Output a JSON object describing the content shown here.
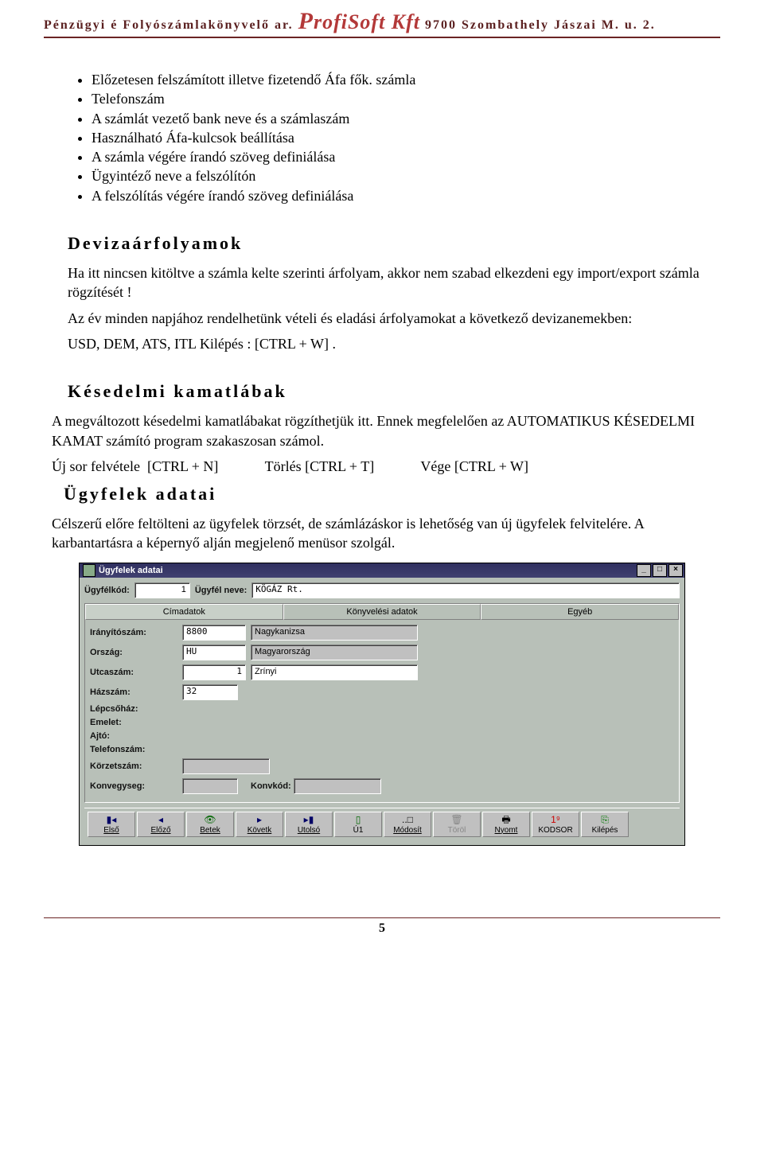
{
  "header": {
    "left": "Pénzügyi é Folyószámlakönyvelő ar.",
    "brand": "ProfiSoft Kft",
    "right": "9700 Szombathely Jászai M. u. 2."
  },
  "bullets": [
    "Előzetesen felszámított illetve fizetendő Áfa fők. számla",
    "Telefonszám",
    "A számlát vezető bank neve és a számlaszám",
    "Használható Áfa-kulcsok beállítása",
    "A számla végére írandó szöveg definiálása",
    "Ügyintéző neve a felszólítón",
    "A felszólítás végére írandó szöveg definiálása"
  ],
  "sec1": {
    "title": "Devizaárfolyamok",
    "p1": "Ha itt nincsen kitöltve a számla kelte szerinti  árfolyam, akkor nem szabad elkezdeni egy import/export számla rögzítését !",
    "p2": "Az év minden napjához rendelhetünk vételi és eladási árfolyamokat a következő devizanemekben:",
    "p3": "USD, DEM, ATS, ITL    Kilépés : [CTRL + W] ."
  },
  "sec2": {
    "title": "Késedelmi kamatlábak",
    "p1": "A megváltozott késedelmi kamatlábakat rögzíthetjük itt. Ennek megfelelően az AUTOMATIKUS KÉSEDELMI KAMAT számító program szakaszosan számol.",
    "p2": "Új sor felvétele  [CTRL + N]             Törlés [CTRL + T]             Vége [CTRL + W]"
  },
  "sec3": {
    "title": "Ügyfelek adatai",
    "p1": "Célszerű előre feltölteni az ügyfelek törzsét, de számlázáskor is lehetőség van új ügyfelek felvitelére. A karbantartásra a képernyő alján megjelenő menüsor szolgál."
  },
  "window": {
    "title": "Ügyfelek adatai",
    "ugyfelkod_label": "Ügyfélkód:",
    "ugyfelkod_value": "1",
    "ugyfelnev_label": "Ügyfél neve:",
    "ugyfelnev_value": "KÖGÁZ Rt.",
    "tabs": {
      "cim": "Címadatok",
      "kony": "Könyvelési adatok",
      "egyeb": "Egyéb"
    },
    "fields": {
      "irsz_label": "Irányítószám:",
      "irsz_val": "8800",
      "irsz_city": "Nagykanizsa",
      "orszag_label": "Ország:",
      "orszag_val": "HU",
      "orszag_name": "Magyarország",
      "utca_label": "Utcaszám:",
      "utca_no": "1",
      "utca_name": "Zrínyi",
      "hsz_label": "Házszám:",
      "hsz_val": "32",
      "lepcso_label": "Lépcsőház:",
      "emelet_label": "Emelet:",
      "ajto_label": "Ajtó:",
      "tel_label": "Telefonszám:",
      "korzet_label": "Körzetszám:",
      "konvegy_label": "Konvegyseg:",
      "konvkod_label": "Konvkód:"
    },
    "toolbar": {
      "elso": "Első",
      "elozo": "Előző",
      "betek": "Betek",
      "kovetk": "Követk",
      "utolso": "Utolsó",
      "uj": "Ú1",
      "modosit": "Módosít",
      "torol": "Töröl",
      "nyomt": "Nyomt",
      "kodsor": "KODSOR",
      "kilepes": "Kilépés"
    }
  },
  "pagenum": "5"
}
